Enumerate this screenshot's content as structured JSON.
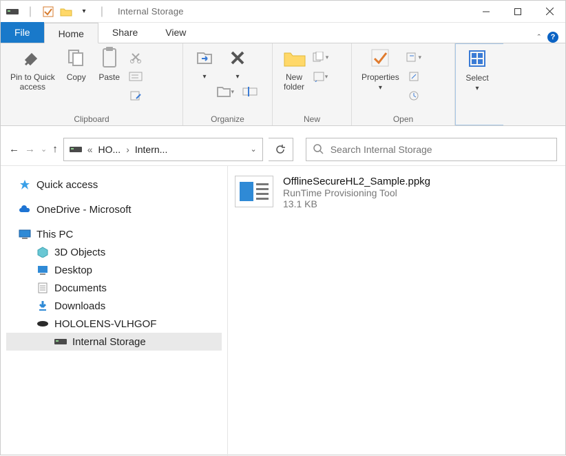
{
  "window": {
    "title": "Internal Storage"
  },
  "tabs": {
    "file": "File",
    "home": "Home",
    "share": "Share",
    "view": "View"
  },
  "ribbon": {
    "clipboard": {
      "label": "Clipboard",
      "pin": "Pin to Quick\naccess",
      "copy": "Copy",
      "paste": "Paste"
    },
    "organize": {
      "label": "Organize"
    },
    "new": {
      "label": "New",
      "newfolder": "New\nfolder"
    },
    "open": {
      "label": "Open",
      "properties": "Properties"
    },
    "select": {
      "label": "Select"
    }
  },
  "breadcrumb": {
    "root_label": "HO...",
    "current_label": "Intern..."
  },
  "search": {
    "placeholder": "Search Internal Storage"
  },
  "tree": {
    "quick_access": "Quick access",
    "onedrive": "OneDrive - Microsoft",
    "this_pc": "This PC",
    "objects3d": "3D Objects",
    "desktop": "Desktop",
    "documents": "Documents",
    "downloads": "Downloads",
    "hololens": "HOLOLENS-VLHGOF",
    "internal_storage": "Internal Storage"
  },
  "file": {
    "name": "OfflineSecureHL2_Sample.ppkg",
    "type": "RunTime Provisioning Tool",
    "size": "13.1 KB"
  }
}
